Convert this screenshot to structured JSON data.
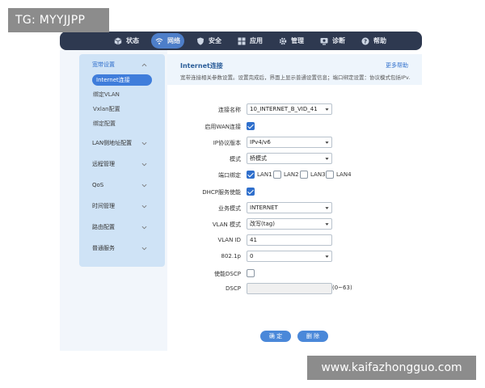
{
  "watermark_top": "TG: MYYJJPP",
  "watermark_bottom": "www.kaifazhongguo.com",
  "nav": [
    {
      "label": "状态",
      "icon": "cube-icon"
    },
    {
      "label": "网络",
      "icon": "wifi-icon"
    },
    {
      "label": "安全",
      "icon": "shield-icon"
    },
    {
      "label": "应用",
      "icon": "grid-icon"
    },
    {
      "label": "管理",
      "icon": "gear-icon"
    },
    {
      "label": "诊断",
      "icon": "monitor-icon"
    },
    {
      "label": "帮助",
      "icon": "help-icon"
    }
  ],
  "nav_active_index": 1,
  "sidebar": {
    "groups": [
      {
        "label": "宽带设置",
        "expanded": true
      },
      {
        "label": "LAN侧地址配置"
      },
      {
        "label": "远程管理"
      },
      {
        "label": "QoS"
      },
      {
        "label": "时间管理"
      },
      {
        "label": "路由配置"
      },
      {
        "label": "普通服务"
      }
    ],
    "sub_items": [
      "Internet连接",
      "绑定VLAN",
      "Vxlan配置",
      "绑定配置"
    ],
    "active_sub_index": 0
  },
  "panel": {
    "title": "Internet连接",
    "help_link": "更多帮助",
    "description": "宽带连接相关参数设置。设置完成后，界面上显示普通设置信息；端口绑定设置：协议模式包括IPv…"
  },
  "form": {
    "connection_name_label": "连接名称",
    "connection_name_value": "10_INTERNET_B_VID_41",
    "enable_wan_label": "启用WAN连接",
    "enable_wan_checked": true,
    "ip_version_label": "IP协议版本",
    "ip_version_value": "IPv4/v6",
    "mode_label": "模式",
    "mode_value": "桥模式",
    "port_binding_label": "端口绑定",
    "ports": [
      {
        "label": "LAN1",
        "checked": true
      },
      {
        "label": "LAN2",
        "checked": false
      },
      {
        "label": "LAN3",
        "checked": false
      },
      {
        "label": "LAN4",
        "checked": false
      }
    ],
    "dhcp_label": "DHCP服务使能",
    "dhcp_checked": true,
    "service_mode_label": "业务模式",
    "service_mode_value": "INTERNET",
    "vlan_mode_label": "VLAN 模式",
    "vlan_mode_value": "改写(tag)",
    "vlan_id_label": "VLAN ID",
    "vlan_id_value": "41",
    "p8021_label": "802.1p",
    "p8021_value": "0",
    "dscp_enable_label": "使能DSCP",
    "dscp_enable_checked": false,
    "dscp_label": "DSCP",
    "dscp_value": "",
    "dscp_hint": "(0~63)"
  },
  "buttons": {
    "confirm": "确 定",
    "delete": "删 除"
  },
  "colors": {
    "nav_bg": "#2e3950",
    "nav_active": "#4d7ec9",
    "sidebar_bg": "#cfe3f6",
    "accent": "#2f6fcc",
    "button": "#4a88d9"
  }
}
